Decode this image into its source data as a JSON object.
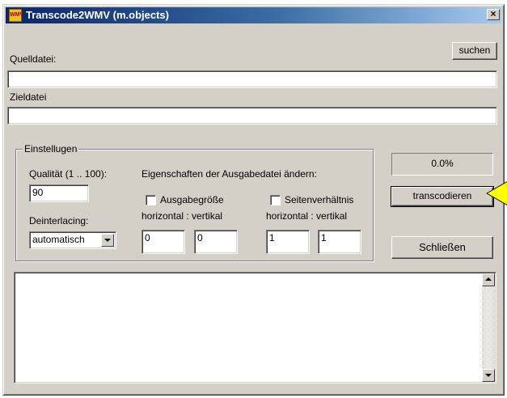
{
  "window": {
    "title": "Transcode2WMV (m.objects)",
    "app_icon_text": "WMV",
    "close_symbol": "×"
  },
  "source": {
    "label": "Quelldatei:",
    "value": "",
    "browse_label": "suchen"
  },
  "target": {
    "label": "Zieldatei",
    "value": ""
  },
  "settings": {
    "group_label": "Einstellugen",
    "quality_label": "Qualität (1 .. 100):",
    "quality_value": "90",
    "deinterlacing_label": "Deinterlacing:",
    "deinterlacing_value": "automatisch",
    "output_props_label": "Eigenschaften der Ausgabedatei ändern:",
    "output_size": {
      "checkbox_label": "Ausgabegröße",
      "checked": false,
      "axis_label": "horizontal : vertikal",
      "horizontal": "0",
      "vertical": "0"
    },
    "aspect_ratio": {
      "checkbox_label": "Seitenverhältnis",
      "checked": false,
      "axis_label": "horizontal : vertikal",
      "horizontal": "1",
      "vertical": "1"
    }
  },
  "progress": {
    "text": "0.0%",
    "fraction": 0.0
  },
  "actions": {
    "transcode_label": "transcodieren",
    "close_label": "Schließen"
  },
  "log": {
    "text": ""
  },
  "colors": {
    "face": "#d4d0c8",
    "title_start": "#0a246a",
    "title_end": "#a6caf0",
    "pointer": "#ffff00"
  }
}
